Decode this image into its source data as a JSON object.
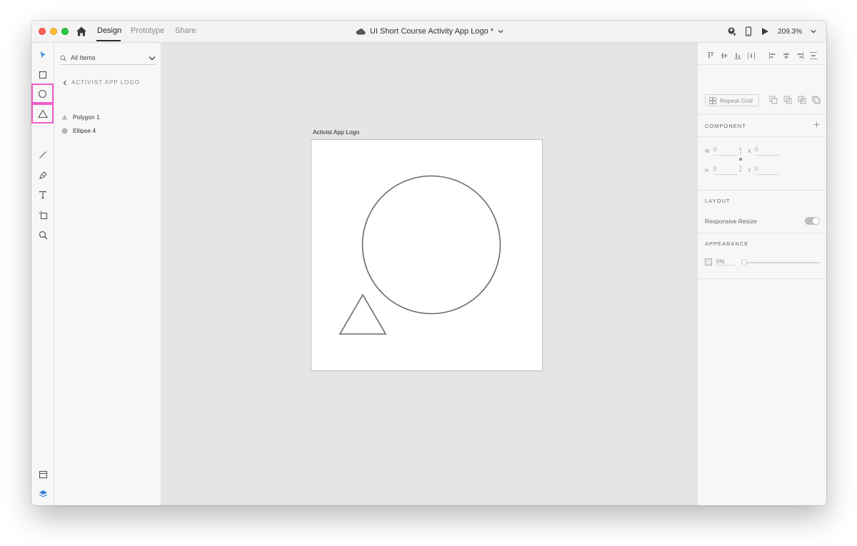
{
  "app": {
    "mode_tabs": [
      {
        "label": "Design",
        "active": true
      },
      {
        "label": "Prototype",
        "active": false
      },
      {
        "label": "Share",
        "active": false
      }
    ],
    "document_title": "UI Short Course Activity App Logo *",
    "zoom": "209.3%"
  },
  "toolbar": {
    "tools": [
      "select-icon",
      "rectangle-icon",
      "ellipse-icon",
      "polygon-icon",
      "line-icon",
      "pen-icon",
      "text-icon",
      "artboard-icon",
      "zoom-icon"
    ],
    "highlighted": [
      "ellipse-icon",
      "polygon-icon"
    ],
    "highlight_color": "#f25cc7"
  },
  "layers": {
    "filter_label": "All Items",
    "breadcrumb": "ACTIVIST APP LOGO",
    "items": [
      {
        "label": "Polygon 1",
        "icon": "triangle"
      },
      {
        "label": "Ellipse 4",
        "icon": "circle"
      }
    ]
  },
  "canvas": {
    "artboard_name": "Activist App Logo"
  },
  "properties": {
    "repeat_grid_label": "Repeat Grid",
    "component_title": "COMPONENT",
    "w_label": "W",
    "w_value": "0",
    "h_label": "H",
    "h_value": "0",
    "x_label": "X",
    "x_value": "0",
    "y_label": "Y",
    "y_value": "0",
    "layout_title": "LAYOUT",
    "responsive_resize_label": "Responsive Resize",
    "appearance_title": "APPEARANCE",
    "opacity_value": "0%"
  }
}
